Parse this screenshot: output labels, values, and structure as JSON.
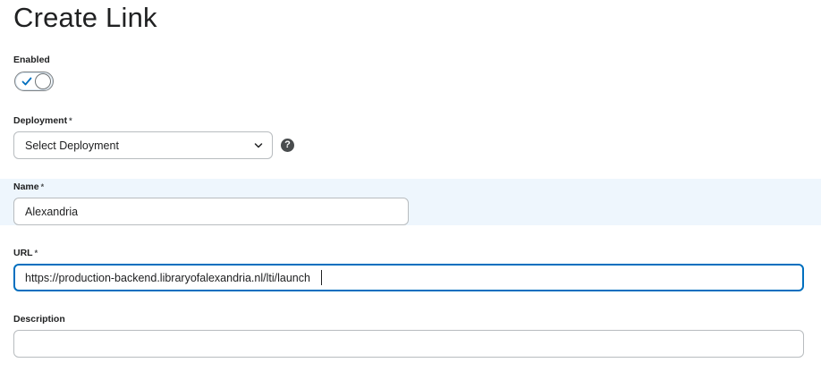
{
  "page": {
    "title": "Create Link"
  },
  "enabled": {
    "label": "Enabled",
    "checked": true
  },
  "deployment": {
    "label": "Deployment",
    "required_mark": "*",
    "selected": "Select Deployment",
    "help_glyph": "?"
  },
  "name": {
    "label": "Name",
    "required_mark": "*",
    "value": "Alexandria"
  },
  "url": {
    "label": "URL",
    "required_mark": "*",
    "value": "https://production-backend.libraryofalexandria.nl/lti/launch"
  },
  "description": {
    "label": "Description",
    "value": ""
  },
  "colors": {
    "accent": "#006fbf",
    "highlight_row": "#eef6fd",
    "text": "#202122"
  },
  "icons": {
    "toggle_check": "checkmark-icon",
    "select_arrow": "chevron-down-icon",
    "help": "help-circle-icon"
  }
}
